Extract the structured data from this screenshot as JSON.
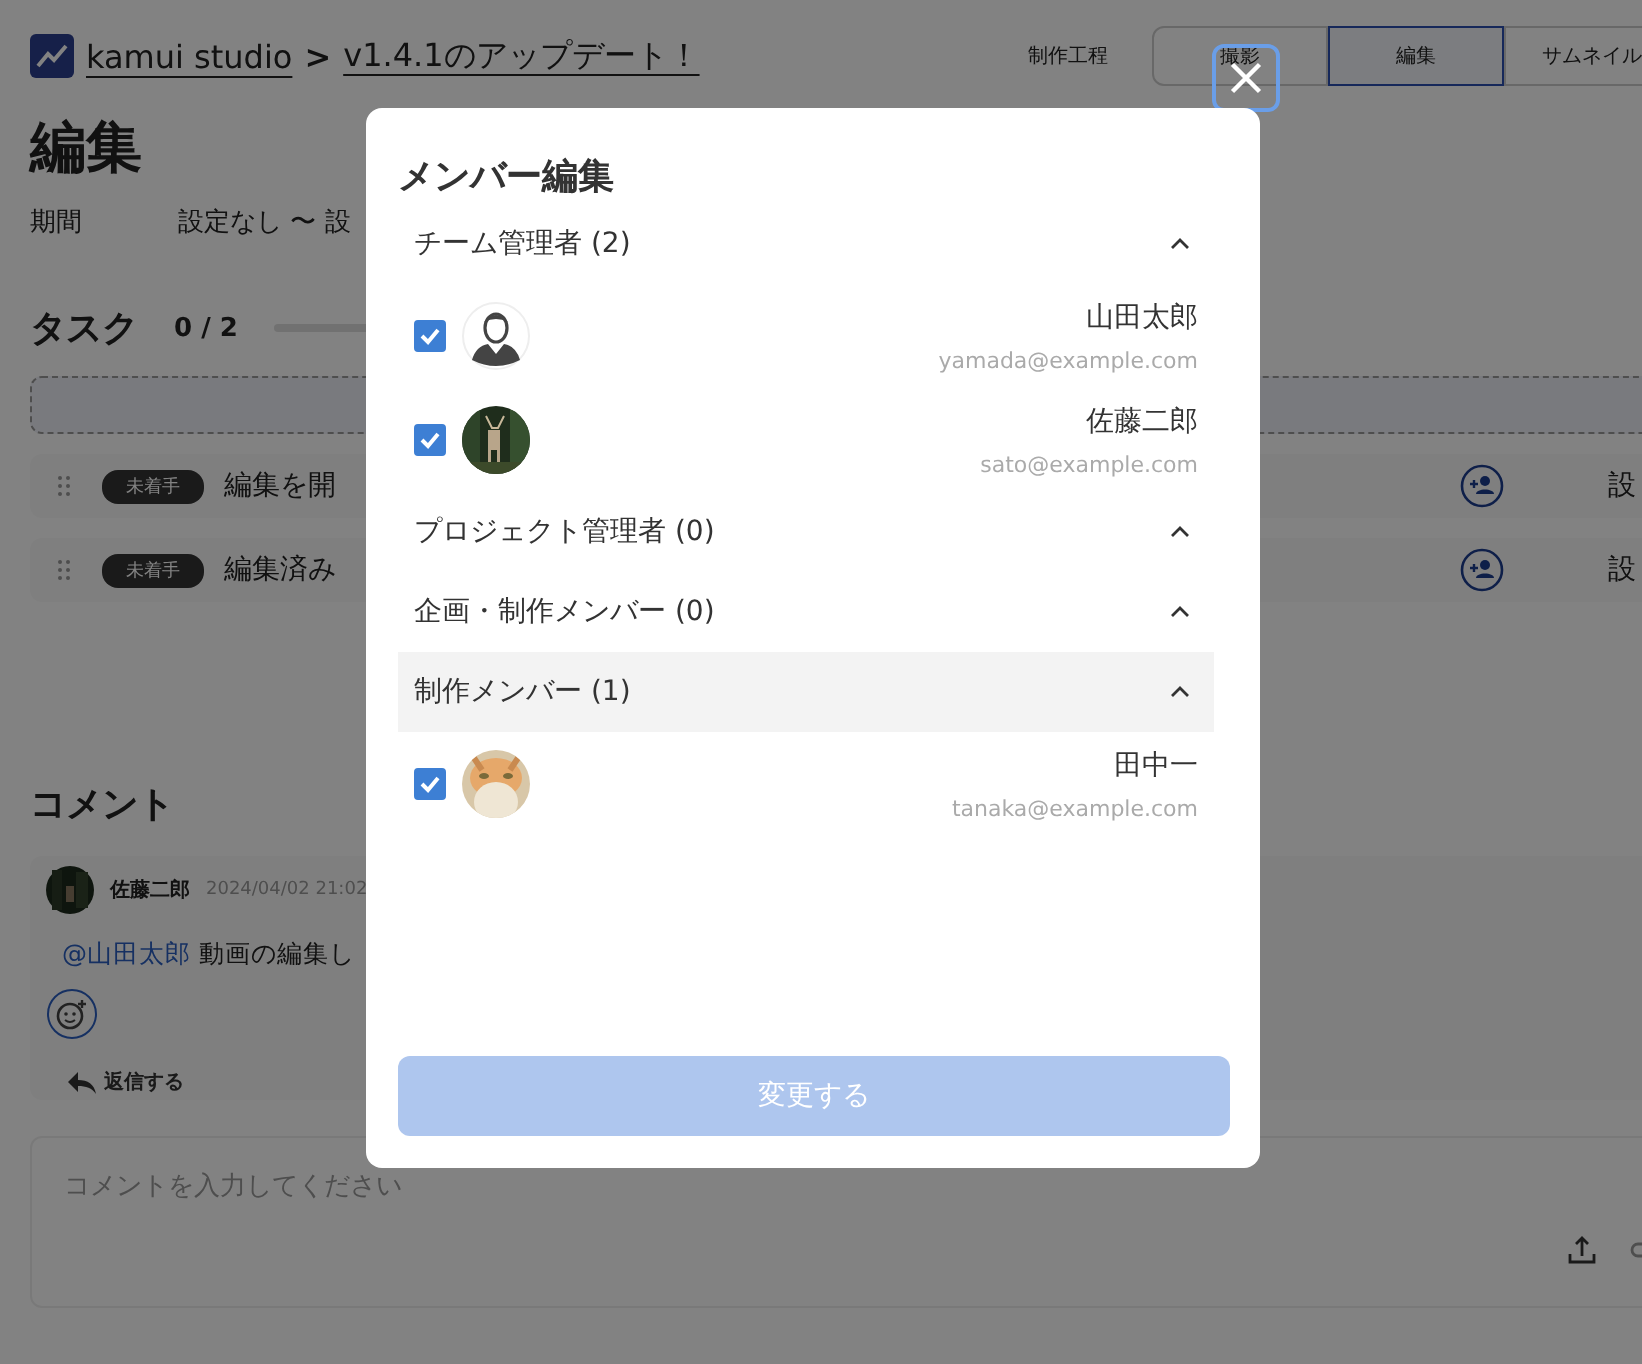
{
  "header": {
    "app_name": "kamui studio",
    "separator": ">",
    "project": "v1.4.1のアップデート！",
    "process_label": "制作工程",
    "process_tabs": [
      {
        "label": "撮影",
        "selected": false
      },
      {
        "label": "編集",
        "selected": true
      },
      {
        "label": "サムネイル",
        "selected": false
      }
    ]
  },
  "page": {
    "title": "編集",
    "period_label": "期間",
    "period_value": "設定なし 〜 設"
  },
  "tasks": {
    "title": "タスク",
    "count": "0 / 2",
    "level": 0,
    "rows": [
      {
        "status": "未着手",
        "name": "編集を開",
        "assignee": "設"
      },
      {
        "status": "未着手",
        "name": "編集済み",
        "assignee": "設"
      }
    ]
  },
  "comments": {
    "title": "コメント",
    "items": [
      {
        "author": "佐藤二郎",
        "time": "2024/04/02 21:02",
        "mention": "@山田太郎",
        "text": "動画の編集し",
        "reply": "返信する"
      }
    ],
    "input": {
      "placeholder": "コメントを入力してください"
    }
  },
  "modal": {
    "title": "メンバー編集",
    "groups": [
      {
        "label": "チーム管理者 (2)",
        "expanded": true,
        "selected": false,
        "members": [
          {
            "name": "山田太郎",
            "email": "yamada@example.com",
            "checked": true,
            "kind": "icon"
          },
          {
            "name": "佐藤二郎",
            "email": "sato@example.com",
            "checked": true,
            "kind": "picture"
          }
        ]
      },
      {
        "label": "プロジェクト管理者 (0)",
        "expanded": true,
        "selected": false
      },
      {
        "label": "企画・制作メンバー (0)",
        "expanded": true,
        "selected": false
      },
      {
        "label": "制作メンバー (1)",
        "expanded": true,
        "selected": true,
        "members": [
          {
            "name": "田中一",
            "email": "tanaka@example.com",
            "checked": true,
            "kind": "picture"
          }
        ]
      }
    ],
    "submit": {
      "label": "変更する",
      "disabled": true
    }
  }
}
